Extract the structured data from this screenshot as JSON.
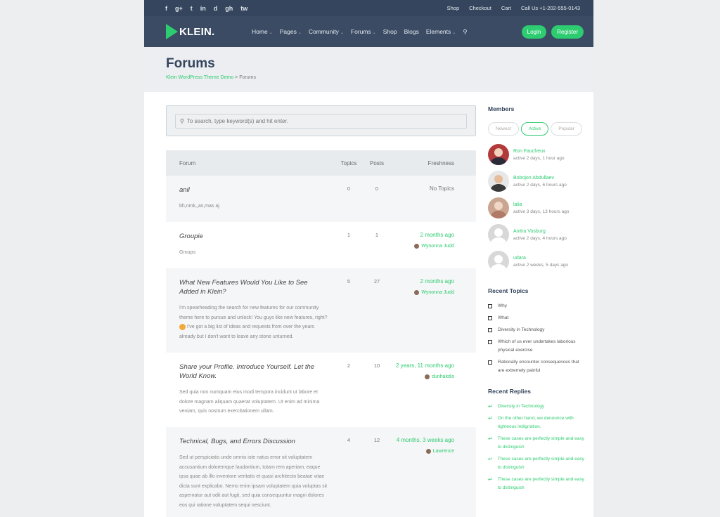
{
  "topbar": {
    "social": [
      "f",
      "g+",
      "t",
      "in",
      "d",
      "gh",
      "tw"
    ],
    "links": [
      "Shop",
      "Checkout",
      "Cart",
      "Call Us +1-202-555-0143"
    ]
  },
  "nav": {
    "logo": "KLEIN.",
    "items": [
      {
        "label": "Home",
        "caret": true
      },
      {
        "label": "Pages",
        "caret": true
      },
      {
        "label": "Community",
        "caret": true
      },
      {
        "label": "Forums",
        "caret": true
      },
      {
        "label": "Shop",
        "caret": false
      },
      {
        "label": "Blogs",
        "caret": false
      },
      {
        "label": "Elements",
        "caret": true
      }
    ],
    "login": "Login",
    "register": "Register"
  },
  "title": {
    "heading": "Forums",
    "crumb_link": "Klein WordPress Theme Demo",
    "crumb_sep": " > ",
    "crumb_current": "Forums"
  },
  "search": {
    "placeholder": "To search, type keyword(s) and hit enter."
  },
  "table": {
    "headers": [
      "Forum",
      "Topics",
      "Posts",
      "Freshness"
    ],
    "rows": [
      {
        "name": "anil",
        "desc": "bh,nmk,,as,mas aj",
        "topics": "0",
        "posts": "0",
        "fresh": "No Topics",
        "by": ""
      },
      {
        "name": "Groupie",
        "desc": "Groups",
        "topics": "1",
        "posts": "1",
        "fresh": "2 months ago",
        "by": "Wynonna Judd"
      },
      {
        "name": "What New Features Would You Like to See Added in Klein?",
        "desc_pre": "I'm spearheading the search for new features for our community theme here to pursue and unlock! You guys like new features, right?",
        "desc_post": " I've got a big list of ideas and requests from over the years already but I don't want to leave any stone unturned.",
        "topics": "5",
        "posts": "27",
        "fresh": "2 months ago",
        "by": "Wynonna Judd"
      },
      {
        "name": "Share your Profile. Introduce Yourself. Let the World Know.",
        "desc": "Sed quia non numquam eius modi tempora incidunt ut labore et dolore magnam aliquam quaerat voluptatem. Ut enim ad minima veniam, quis nostrum exercitationem ullam.",
        "topics": "2",
        "posts": "10",
        "fresh": "2 years, 11 months ago",
        "by": "dunhakdis"
      },
      {
        "name": "Technical, Bugs, and Errors Discussion",
        "desc": "Sed ut perspiciatis unde omnis iste natus error sit voluptatem accusantium doloremque laudantium, totam rem aperiam, eaque ipsa quae ab illo inventore veritatis et quasi architecto beatae vitae dicta sunt explicabo. Nemo enim ipsam voluptatem quia voluptas sit aspernatur aut odit aut fugit, sed quia consequuntur magni dolores eos qui ratione voluptatem sequi nesciunt.",
        "topics": "4",
        "posts": "12",
        "fresh": "4 months, 3 weeks ago",
        "by": "Lawrence"
      }
    ]
  },
  "sidebar": {
    "members_title": "Members",
    "pills": [
      "Newest",
      "Active",
      "Popular"
    ],
    "members": [
      {
        "name": "Ron Faucheux",
        "active": "active 2 days, 1 hour ago"
      },
      {
        "name": "Bobojon Abdullaev",
        "active": "active 2 days, 6 hours ago"
      },
      {
        "name": "lalia",
        "active": "active 3 days, 13 hours ago"
      },
      {
        "name": "Anitra Vosburg",
        "active": "active 2 days, 4 hours ago"
      },
      {
        "name": "udara",
        "active": "active 2 weeks, 5 days ago"
      }
    ],
    "topics_title": "Recent Topics",
    "topics": [
      "Why",
      "What",
      "Diversity in Technology",
      "Which of us ever undertakes laborious physical exercise",
      "Rationally encounter consequences that are extremely painful"
    ],
    "replies_title": "Recent Replies",
    "replies": [
      "Diversity in Technology",
      "On the other hand, we denounce with righteous indignation.",
      "These cases are perfectly simple and easy to distinguish",
      "These cases are perfectly simple and easy to distinguish",
      "These cases are perfectly simple and easy to distinguish"
    ]
  }
}
